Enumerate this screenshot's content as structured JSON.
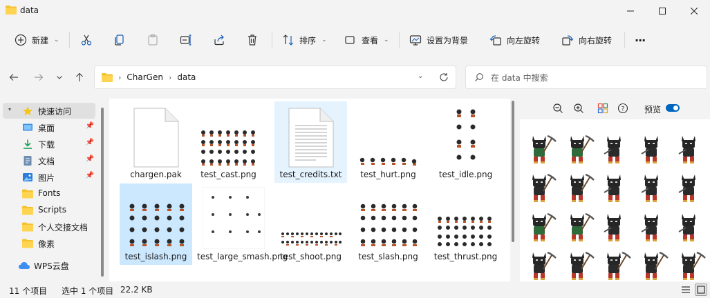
{
  "window": {
    "title": "data",
    "controls": [
      "minimize-icon",
      "maximize-icon",
      "close-icon"
    ]
  },
  "toolbar": {
    "new_label": "新建",
    "sort_label": "排序",
    "view_label": "查看",
    "set_bg_label": "设置为背景",
    "rotate_left_label": "向左旋转",
    "rotate_right_label": "向右旋转",
    "more_label": "···",
    "icons": [
      "cut-icon",
      "copy-icon",
      "paste-icon",
      "rename-icon",
      "share-icon",
      "delete-icon"
    ]
  },
  "address": {
    "crumbs": [
      "CharGen",
      "data"
    ]
  },
  "search": {
    "placeholder": "在 data 中搜索"
  },
  "sidebar": {
    "items": [
      {
        "label": "快速访问",
        "icon": "star-icon",
        "pinned": false
      },
      {
        "label": "桌面",
        "icon": "desktop-icon",
        "pinned": true
      },
      {
        "label": "下载",
        "icon": "download-icon",
        "pinned": true
      },
      {
        "label": "文档",
        "icon": "document-icon",
        "pinned": true
      },
      {
        "label": "图片",
        "icon": "picture-icon",
        "pinned": true
      },
      {
        "label": "Fonts",
        "icon": "folder-icon",
        "pinned": false
      },
      {
        "label": "Scripts",
        "icon": "folder-icon",
        "pinned": false
      },
      {
        "label": "个人交接文档",
        "icon": "folder-icon",
        "pinned": false
      },
      {
        "label": "像素",
        "icon": "folder-icon",
        "pinned": false
      },
      {
        "label": "WPS云盘",
        "icon": "cloud-icon",
        "pinned": false
      }
    ]
  },
  "files": [
    {
      "name": "chargen.pak",
      "type": "blank"
    },
    {
      "name": "test_cast.png",
      "type": "sprites"
    },
    {
      "name": "test_credits.txt",
      "type": "text",
      "state": "hovered"
    },
    {
      "name": "test_hurt.png",
      "type": "strip"
    },
    {
      "name": "test_idle.png",
      "type": "tall"
    },
    {
      "name": "test_islash.png",
      "type": "sprites",
      "state": "selected"
    },
    {
      "name": "test_large_smash.png",
      "type": "sparse"
    },
    {
      "name": "test_shoot.png",
      "type": "strip"
    },
    {
      "name": "test_slash.png",
      "type": "sprites"
    },
    {
      "name": "test_thrust.png",
      "type": "sprites"
    }
  ],
  "preview": {
    "toggle_label": "预览",
    "toggle_on": true,
    "icons": [
      "zoom-out-icon",
      "zoom-in-icon",
      "fit-icon",
      "help-icon"
    ]
  },
  "status": {
    "count": "11 个项目",
    "selection": "选中 1 个项目",
    "size": "22.2 KB"
  },
  "colors": {
    "accent": "#0067c0",
    "selected": "#cce8ff",
    "hover": "#e5f3ff",
    "folder": "#f2c231"
  }
}
